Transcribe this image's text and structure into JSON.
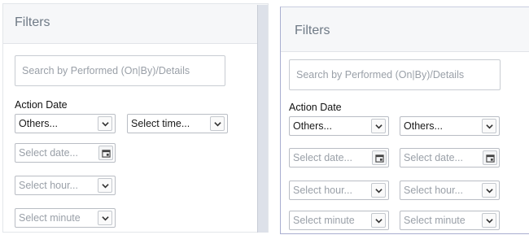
{
  "left_panel": {
    "title": "Filters",
    "search": {
      "placeholder": "Search by Performed (On|By)/Details",
      "value": ""
    },
    "action_date": {
      "label": "Action Date",
      "option_select": "Others...",
      "time_select": "Select time...",
      "date_placeholder": "Select date...",
      "hour_placeholder": "Select hour...",
      "minute_placeholder": "Select minute"
    }
  },
  "right_panel": {
    "title": "Filters",
    "search": {
      "placeholder": "Search by Performed (On|By)/Details",
      "value": ""
    },
    "action_date": {
      "label": "Action Date",
      "from": {
        "option_select": "Others...",
        "date_placeholder": "Select date...",
        "hour_placeholder": "Select hour...",
        "minute_placeholder": "Select minute"
      },
      "to": {
        "option_select": "Others...",
        "date_placeholder": "Select date...",
        "hour_placeholder": "Select hour...",
        "minute_placeholder": "Select minute"
      }
    }
  },
  "icons": {
    "dropdown": "chevron-down-icon",
    "calendar": "calendar-icon"
  },
  "colors": {
    "header_bg": "#f6f7f9",
    "title_text": "#6f7a86",
    "placeholder_text": "#9aa0a8",
    "scrollbar": "#dde1e9"
  }
}
